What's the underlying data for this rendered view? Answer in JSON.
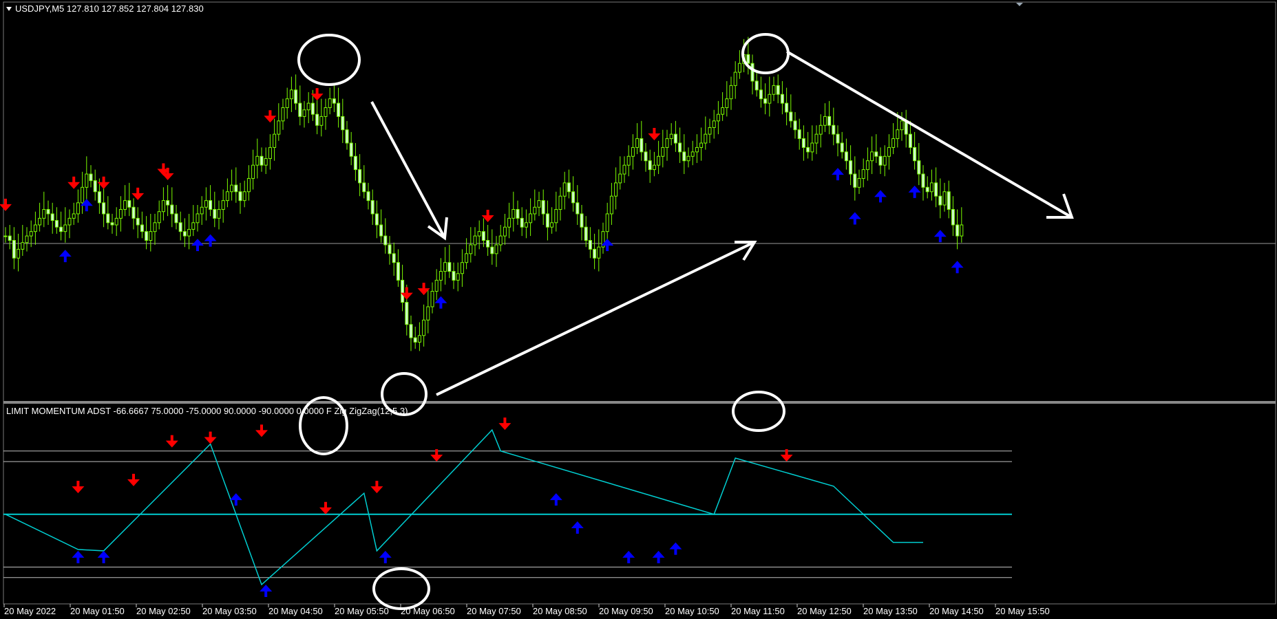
{
  "window": {
    "symbol_header": "USDJPY,M5  127.810 127.852 127.804 127.830",
    "indicator_header": "LIMIT MOMENTUM ADST -66.6667 75.0000 -75.0000 90.0000 -90.0000 0.0000  F Zig  ZigZag(12,5,3)"
  },
  "colors": {
    "background": "#000000",
    "candle": "#7CFC00",
    "candle_body": "#CCFFCC",
    "sell_arrow": "#FF0000",
    "buy_arrow": "#0000FF",
    "zigzag": "#00CED1",
    "level_line": "#C0C0C0",
    "annotation": "#FFFFFF"
  },
  "chart_data": [
    {
      "type": "candlestick",
      "symbol": "USDJPY",
      "timeframe": "M5",
      "ohlc": [
        127.81,
        127.852,
        127.804,
        127.83
      ],
      "x_ticks": [
        "20 May 2022",
        "20 May 01:50",
        "20 May 02:50",
        "20 May 03:50",
        "20 May 04:50",
        "20 May 05:50",
        "20 May 06:50",
        "20 May 07:50",
        "20 May 08:50",
        "20 May 09:50",
        "20 May 10:50",
        "20 May 11:50",
        "20 May 12:50",
        "20 May 13:50",
        "20 May 14:50",
        "20 May 15:50"
      ],
      "closes": [
        50,
        48,
        40,
        44,
        47,
        50,
        52,
        55,
        58,
        62,
        60,
        57,
        54,
        52,
        55,
        58,
        60,
        65,
        72,
        78,
        75,
        70,
        65,
        60,
        56,
        55,
        58,
        62,
        66,
        63,
        58,
        55,
        52,
        48,
        52,
        56,
        61,
        66,
        64,
        60,
        56,
        52,
        50,
        53,
        56,
        60,
        63,
        66,
        62,
        58,
        62,
        66,
        70,
        73,
        70,
        66,
        70,
        76,
        82,
        86,
        82,
        85,
        90,
        96,
        102,
        108,
        112,
        116,
        110,
        104,
        107,
        110,
        105,
        100,
        104,
        108,
        112,
        110,
        104,
        98,
        92,
        86,
        80,
        74,
        70,
        66,
        60,
        55,
        50,
        46,
        42,
        38,
        30,
        20,
        10,
        4,
        2,
        5,
        12,
        18,
        25,
        30,
        34,
        38,
        34,
        30,
        33,
        38,
        42,
        46,
        50,
        52,
        48,
        45,
        42,
        46,
        50,
        54,
        58,
        62,
        58,
        54,
        56,
        60,
        63,
        66,
        60,
        54,
        56,
        62,
        68,
        74,
        70,
        65,
        60,
        54,
        48,
        44,
        40,
        45,
        52,
        60,
        68,
        74,
        78,
        82,
        86,
        90,
        94,
        88,
        84,
        80,
        82,
        86,
        90,
        94,
        96,
        92,
        88,
        84,
        86,
        88,
        90,
        92,
        96,
        99,
        102,
        105,
        108,
        112,
        118,
        124,
        128,
        132,
        128,
        120,
        116,
        112,
        110,
        114,
        118,
        114,
        110,
        106,
        102,
        98,
        94,
        90,
        88,
        92,
        96,
        100,
        104,
        100,
        96,
        92,
        88,
        84,
        78,
        72,
        76,
        80,
        84,
        88,
        86,
        82,
        86,
        90,
        94,
        98,
        102,
        96,
        90,
        84,
        78,
        72,
        70,
        74,
        68,
        64,
        70,
        62,
        55,
        50,
        55
      ],
      "sell_signals": [
        0,
        16,
        23,
        31,
        37,
        38,
        62,
        73,
        94,
        98,
        113,
        152
      ],
      "buy_signals": [
        14,
        19,
        45,
        48,
        102,
        141,
        195,
        199,
        205,
        213,
        219,
        223
      ],
      "annotations": [
        "circle at top near 05:00",
        "arrow down",
        "circle at bottom near 06:30",
        "arrow up",
        "circle at top near 11:40",
        "arrow down"
      ]
    },
    {
      "type": "line",
      "name": "ZigZag(12,5,3)",
      "levels": [
        90,
        75,
        0,
        -75,
        -90
      ],
      "x": [
        0,
        17,
        23,
        48,
        60,
        84,
        87,
        114,
        116,
        166,
        171,
        194,
        208,
        215
      ],
      "y": [
        0,
        -50,
        -52,
        100,
        -100,
        30,
        -52,
        120,
        90,
        0,
        80,
        40,
        -40,
        -40
      ],
      "sell_signals": [
        [
          17,
          30
        ],
        [
          30,
          40
        ],
        [
          39,
          95
        ],
        [
          48,
          100
        ],
        [
          60,
          110
        ],
        [
          75,
          0
        ],
        [
          87,
          30
        ],
        [
          101,
          75
        ],
        [
          117,
          120
        ],
        [
          183,
          75
        ]
      ],
      "buy_signals": [
        [
          17,
          -52
        ],
        [
          23,
          -52
        ],
        [
          54,
          30
        ],
        [
          61,
          -100
        ],
        [
          89,
          -52
        ],
        [
          129,
          30
        ],
        [
          134,
          -10
        ],
        [
          146,
          -52
        ],
        [
          153,
          -52
        ],
        [
          157,
          -40
        ]
      ]
    }
  ]
}
